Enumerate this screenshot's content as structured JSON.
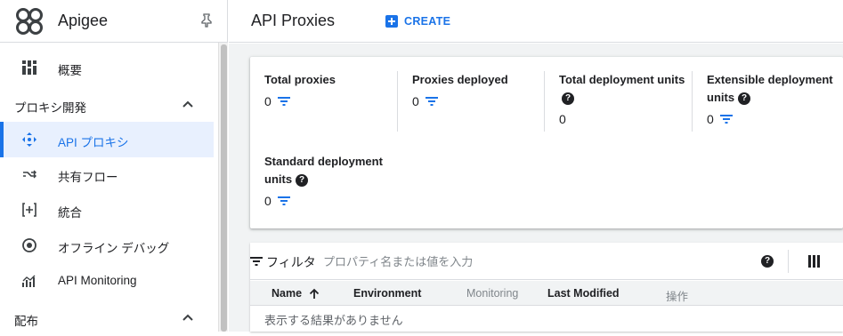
{
  "brand": {
    "name": "Apigee"
  },
  "sidebar": {
    "items": [
      {
        "label": "概要"
      },
      {
        "label": "API プロキシ"
      },
      {
        "label": "共有フロー"
      },
      {
        "label": "統合"
      },
      {
        "label": "オフライン デバッグ"
      },
      {
        "label": "API Monitoring"
      }
    ],
    "sections": [
      {
        "label": "プロキシ開発"
      },
      {
        "label": "配布"
      }
    ]
  },
  "header": {
    "title": "API Proxies",
    "create_label": "CREATE"
  },
  "metrics": [
    {
      "label": "Total proxies",
      "value": "0"
    },
    {
      "label": "Proxies deployed",
      "value": "0"
    },
    {
      "label": "Total deployment units",
      "value": "0"
    },
    {
      "label": "Extensible deployment units",
      "value": "0"
    },
    {
      "label": "Standard deployment units",
      "value": "0"
    }
  ],
  "filter": {
    "label": "フィルタ",
    "placeholder": "プロパティ名または値を入力"
  },
  "table": {
    "columns": [
      "Name",
      "Environment",
      "Monitoring",
      "Last Modified",
      "操作"
    ],
    "empty_message": "表示する結果がありません"
  },
  "colors": {
    "accent": "#1a73e8",
    "active_bg": "#e8f0fe",
    "background": "#f1f3f4"
  }
}
